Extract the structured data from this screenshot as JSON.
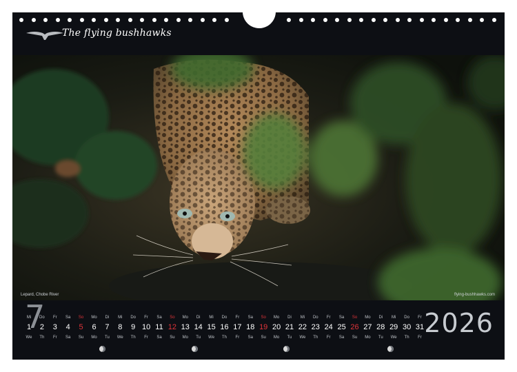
{
  "header": {
    "brand": "The flying bushhawks",
    "logo_icon": "hawk-logo-icon"
  },
  "photo": {
    "caption_left": "Lepard, Chobe River",
    "caption_right": "flying-bushhawks.com"
  },
  "calendar": {
    "month_number": "7",
    "year": "2026",
    "sunday_color": "#e0343a",
    "days": [
      {
        "d": "1",
        "n": "Mi",
        "w": "We"
      },
      {
        "d": "2",
        "n": "Do",
        "w": "Th"
      },
      {
        "d": "3",
        "n": "Fr",
        "w": "Fr"
      },
      {
        "d": "4",
        "n": "Sa",
        "w": "Sa"
      },
      {
        "d": "5",
        "n": "So",
        "w": "Su",
        "sun": true
      },
      {
        "d": "6",
        "n": "Mo",
        "w": "Mo"
      },
      {
        "d": "7",
        "n": "Di",
        "w": "Tu"
      },
      {
        "d": "8",
        "n": "Mi",
        "w": "We"
      },
      {
        "d": "9",
        "n": "Do",
        "w": "Th"
      },
      {
        "d": "10",
        "n": "Fr",
        "w": "Fr"
      },
      {
        "d": "11",
        "n": "Sa",
        "w": "Sa"
      },
      {
        "d": "12",
        "n": "So",
        "w": "Su",
        "sun": true
      },
      {
        "d": "13",
        "n": "Mo",
        "w": "Mo"
      },
      {
        "d": "14",
        "n": "Di",
        "w": "Tu"
      },
      {
        "d": "15",
        "n": "Mi",
        "w": "We"
      },
      {
        "d": "16",
        "n": "Do",
        "w": "Th"
      },
      {
        "d": "17",
        "n": "Fr",
        "w": "Fr"
      },
      {
        "d": "18",
        "n": "Sa",
        "w": "Sa"
      },
      {
        "d": "19",
        "n": "So",
        "w": "Su",
        "sun": true
      },
      {
        "d": "20",
        "n": "Mo",
        "w": "Mo"
      },
      {
        "d": "21",
        "n": "Di",
        "w": "Tu"
      },
      {
        "d": "22",
        "n": "Mi",
        "w": "We"
      },
      {
        "d": "23",
        "n": "Do",
        "w": "Th"
      },
      {
        "d": "24",
        "n": "Fr",
        "w": "Fr"
      },
      {
        "d": "25",
        "n": "Sa",
        "w": "Sa"
      },
      {
        "d": "26",
        "n": "So",
        "w": "Su",
        "sun": true
      },
      {
        "d": "27",
        "n": "Mo",
        "w": "Mo"
      },
      {
        "d": "28",
        "n": "Di",
        "w": "Tu"
      },
      {
        "d": "29",
        "n": "Mi",
        "w": "We"
      },
      {
        "d": "30",
        "n": "Do",
        "w": "Th"
      },
      {
        "d": "31",
        "n": "Fr",
        "w": "Fr"
      }
    ],
    "moon_phases": [
      "full-moon-icon",
      "last-quarter-moon-icon",
      "new-moon-icon",
      "first-quarter-moon-icon"
    ]
  }
}
